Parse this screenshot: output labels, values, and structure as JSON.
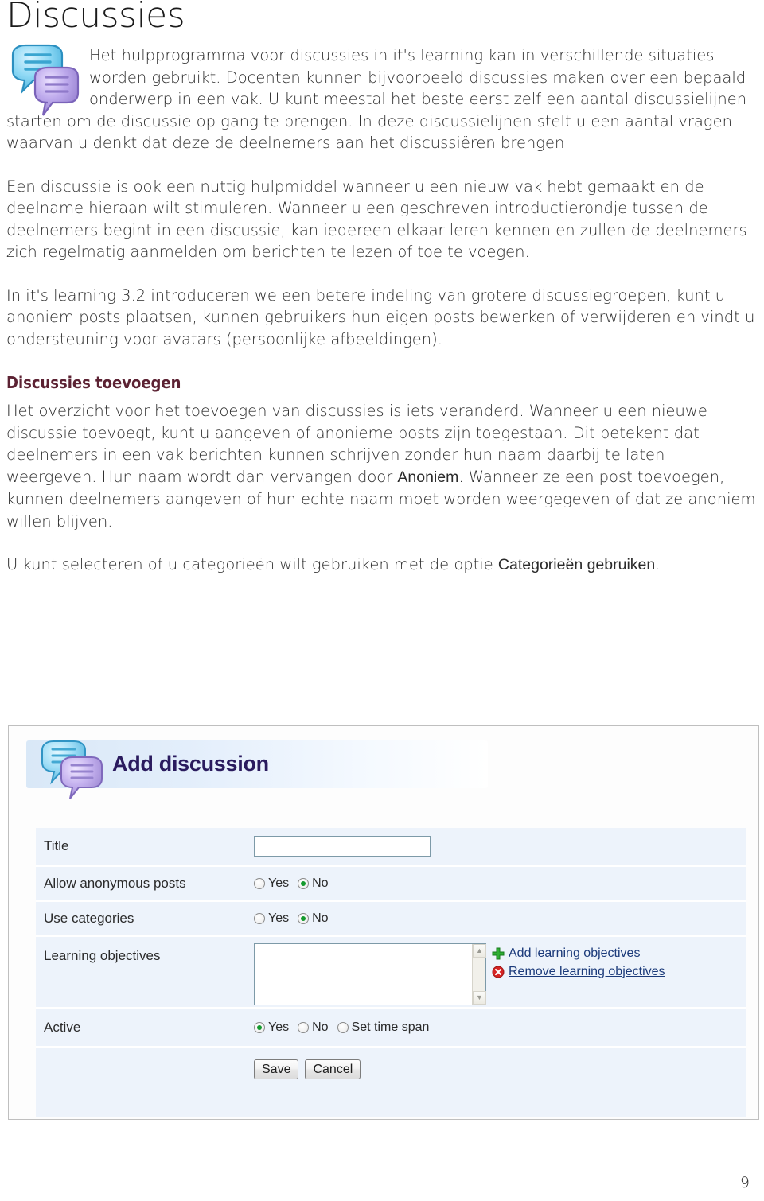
{
  "document": {
    "title": "Discussies",
    "page_number": "9"
  },
  "icons": {
    "intro": "discussion-bubbles-icon",
    "header": "discussion-bubbles-icon",
    "add": "green-plus-icon",
    "remove": "red-x-circle-icon",
    "scroll_up": "scroll-up-arrow-icon",
    "scroll_down": "scroll-down-arrow-icon"
  },
  "colors": {
    "heading": "#5c2233",
    "link": "#1b3a7a",
    "radio_selected": "#149a2e",
    "row_background": "#edf3fb",
    "panel_title": "#2a1b5e"
  },
  "body": {
    "p1": "Het hulpprogramma voor discussies in it's learning kan in verschillende situaties worden gebruikt. Docenten kunnen bijvoorbeeld discussies maken over een bepaald onderwerp in een vak. U kunt meestal het beste eerst zelf een aantal discussielijnen starten om de discussie op gang te brengen. In deze discussielijnen stelt u een aantal vragen waarvan u denkt dat deze de deelnemers aan het discussiëren brengen.",
    "p2": "Een discussie is ook een nuttig hulpmiddel wanneer u een nieuw vak hebt gemaakt en de deelname hieraan wilt stimuleren. Wanneer u een geschreven introductierondje tussen de deelnemers begint in een discussie, kan iedereen elkaar leren kennen en zullen de deelnemers zich regelmatig aanmelden om berichten te lezen of toe te voegen.",
    "p3": "In it's learning 3.2 introduceren we een betere indeling van grotere discussiegroepen, kunt u anoniem posts plaatsen, kunnen gebruikers hun eigen posts bewerken of verwijderen en vindt u ondersteuning voor avatars (persoonlijke afbeeldingen).",
    "subheading": "Discussies toevoegen",
    "p4_before": "Het overzicht voor het toevoegen van discussies is iets veranderd. Wanneer u een nieuwe discussie toevoegt, kunt u aangeven of anonieme posts zijn toegestaan. Dit betekent dat deelnemers in een vak berichten kunnen schrijven zonder hun naam daarbij te laten weergeven. Hun naam wordt dan vervangen door ",
    "p4_emphasis": "Anoniem",
    "p4_after": ". Wanneer ze een post toevoegen, kunnen deelnemers aangeven of hun echte naam moet worden weergegeven of dat ze anoniem willen blijven.",
    "p5_before": "U kunt selecteren of u categorieën wilt gebruiken met de optie ",
    "p5_emphasis": "Categorieën gebruiken",
    "p5_after": "."
  },
  "screenshot": {
    "panel_title": "Add discussion",
    "fields": {
      "title": {
        "label": "Title",
        "value": "",
        "placeholder": ""
      },
      "allow_anonymous_posts": {
        "label": "Allow anonymous posts",
        "options": [
          "Yes",
          "No"
        ],
        "selected": "No"
      },
      "use_categories": {
        "label": "Use categories",
        "options": [
          "Yes",
          "No"
        ],
        "selected": "No"
      },
      "learning_objectives": {
        "label": "Learning objectives",
        "items": [],
        "add_link": "Add learning objectives",
        "remove_link": "Remove learning objectives"
      },
      "active": {
        "label": "Active",
        "options": [
          "Yes",
          "No",
          "Set time span"
        ],
        "selected": "Yes"
      }
    },
    "buttons": {
      "save": "Save",
      "cancel": "Cancel"
    }
  }
}
